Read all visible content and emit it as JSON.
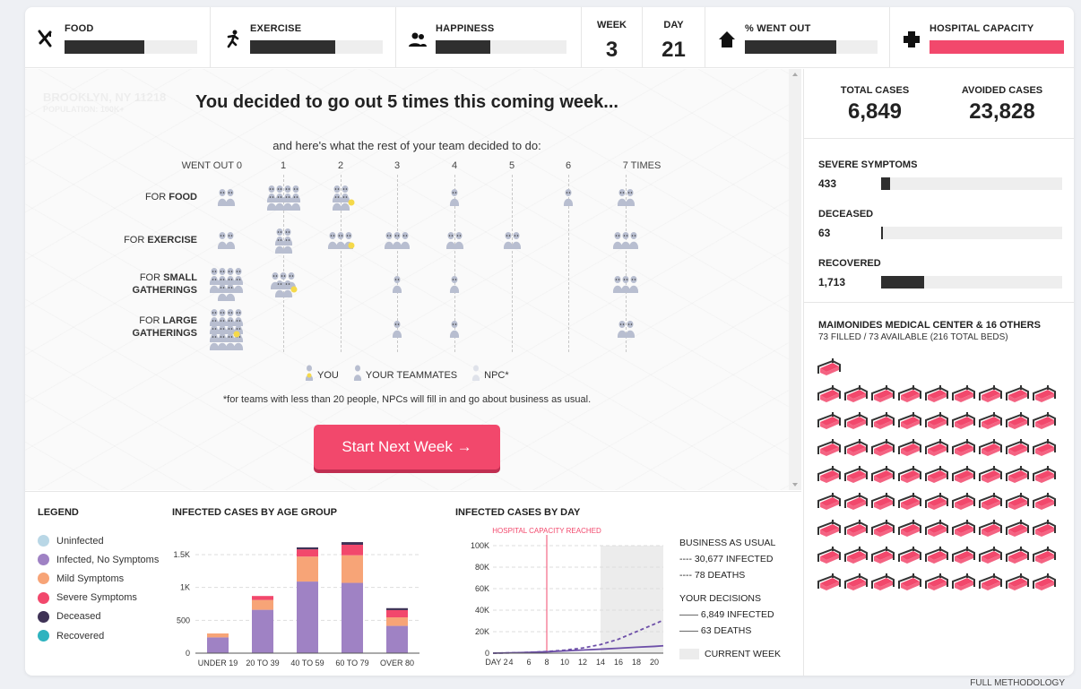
{
  "topbar": {
    "food": {
      "label": "FOOD",
      "level": 0.6
    },
    "exercise": {
      "label": "EXERCISE",
      "level": 0.64
    },
    "happiness": {
      "label": "HAPPINESS",
      "level": 0.42
    },
    "week": {
      "label": "WEEK",
      "value": "3"
    },
    "day": {
      "label": "DAY",
      "value": "21"
    },
    "went_out": {
      "label": "% WENT OUT",
      "level": 0.69
    },
    "hospital": {
      "label": "HOSPITAL CAPACITY",
      "level": 1.0,
      "color": "#f2486c"
    }
  },
  "main": {
    "location_ghost": "BROOKLYN, NY 11218",
    "population_ghost": "POPULATION: 100K+",
    "headline": "You decided to go out 5 times this coming week...",
    "subhead": "and here's what the rest of your team decided to do:",
    "columns": [
      "WENT OUT 0",
      "1",
      "2",
      "3",
      "4",
      "5",
      "6",
      "7 TIMES"
    ],
    "rows": [
      {
        "pre": "FOR ",
        "bold": "FOOD",
        "counts": [
          2,
          8,
          4,
          0,
          1,
          0,
          1,
          2
        ],
        "you": 2
      },
      {
        "pre": "FOR ",
        "bold": "EXERCISE",
        "counts": [
          2,
          4,
          3,
          3,
          2,
          2,
          0,
          3
        ],
        "you": 2
      },
      {
        "pre": "FOR ",
        "bold": "SMALL GATHERINGS",
        "counts": [
          10,
          5,
          0,
          1,
          1,
          0,
          0,
          3
        ],
        "you": 1
      },
      {
        "pre": "FOR ",
        "bold": "LARGE GATHERINGS",
        "counts": [
          16,
          0,
          0,
          1,
          1,
          0,
          0,
          2
        ],
        "you": 0
      }
    ],
    "legend": {
      "you": "YOU",
      "teammates": "YOUR TEAMMATES",
      "npc": "NPC*"
    },
    "footnote": "*for teams with less than 20 people, NPCs will fill in and go about business as usual.",
    "cta": "Start Next Week →",
    "colors": {
      "figure": "#b8bed0",
      "you": "#f5d94a",
      "accent": "#f2486c"
    }
  },
  "right": {
    "total_cases_label": "TOTAL CASES",
    "total_cases": "6,849",
    "avoided_label": "AVOIDED CASES",
    "avoided": "23,828",
    "severe": {
      "label": "SEVERE SYMPTOMS",
      "value": "433",
      "level": 0.05
    },
    "deceased": {
      "label": "DECEASED",
      "value": "63",
      "level": 0.01
    },
    "recovered": {
      "label": "RECOVERED",
      "value": "1,713",
      "level": 0.24
    },
    "hospital_title": "MAIMONIDES MEDICAL CENTER & 16 OTHERS",
    "hospital_sub": "73 FILLED / 73 AVAILABLE (216 TOTAL BEDS)",
    "beds_shown": 73,
    "bed_color": "#f2486c"
  },
  "bottom": {
    "legend_title": "LEGEND",
    "legend": [
      {
        "label": "Uninfected",
        "color": "#b9d7e6"
      },
      {
        "label": "Infected, No Symptoms",
        "color": "#9f82c4"
      },
      {
        "label": "Mild Symptoms",
        "color": "#f7a477"
      },
      {
        "label": "Severe Symptoms",
        "color": "#f2486c"
      },
      {
        "label": "Deceased",
        "color": "#3f3256"
      },
      {
        "label": "Recovered",
        "color": "#2eb3bf"
      }
    ],
    "age_title": "INFECTED CASES BY AGE GROUP",
    "day_title": "INFECTED CASES BY DAY",
    "capacity_label": "HOSPITAL CAPACITY REACHED",
    "bau_title": "BUSINESS AS USUAL",
    "bau_infected": "---- 30,677 INFECTED",
    "bau_deaths": "---- 78 DEATHS",
    "yours_title": "YOUR DECISIONS",
    "yours_infected": "—— 6,849 INFECTED",
    "yours_deaths": "—— 63 DEATHS",
    "current_week": "CURRENT WEEK"
  },
  "chart_data": [
    {
      "type": "bar",
      "title": "INFECTED CASES BY AGE GROUP",
      "categories": [
        "UNDER 19",
        "20 TO 39",
        "40 TO 59",
        "60 TO 79",
        "OVER 80"
      ],
      "ylim": [
        0,
        1800
      ],
      "yticks": [
        "0",
        "500",
        "1K",
        "1.5K"
      ],
      "series": [
        {
          "name": "Infected, No Symptoms",
          "values": [
            240,
            660,
            1090,
            1070,
            415
          ]
        },
        {
          "name": "Mild Symptoms",
          "values": [
            60,
            150,
            380,
            420,
            130
          ]
        },
        {
          "name": "Severe Symptoms",
          "values": [
            0,
            60,
            110,
            160,
            110
          ]
        },
        {
          "name": "Deceased",
          "values": [
            0,
            0,
            30,
            40,
            30
          ]
        }
      ]
    },
    {
      "type": "line",
      "title": "INFECTED CASES BY DAY",
      "xlim": [
        2,
        21
      ],
      "ylim": [
        0,
        100000
      ],
      "xticks": [
        "DAY 2",
        "4",
        "6",
        "8",
        "10",
        "12",
        "14",
        "16",
        "18",
        "20"
      ],
      "yticks": [
        "0",
        "20K",
        "40K",
        "60K",
        "80K",
        "100K"
      ],
      "capacity_day": 8,
      "current_week": [
        14,
        21
      ],
      "series": [
        {
          "name": "BUSINESS AS USUAL",
          "x": [
            2,
            4,
            6,
            8,
            10,
            12,
            14,
            16,
            18,
            20,
            21
          ],
          "y": [
            0,
            300,
            700,
            1500,
            2800,
            4800,
            8000,
            13000,
            20000,
            27000,
            30677
          ]
        },
        {
          "name": "YOUR DECISIONS",
          "x": [
            2,
            4,
            6,
            8,
            10,
            12,
            14,
            16,
            18,
            20,
            21
          ],
          "y": [
            0,
            300,
            700,
            1300,
            2100,
            2900,
            3700,
            4600,
            5500,
            6300,
            6849
          ]
        }
      ]
    }
  ]
}
